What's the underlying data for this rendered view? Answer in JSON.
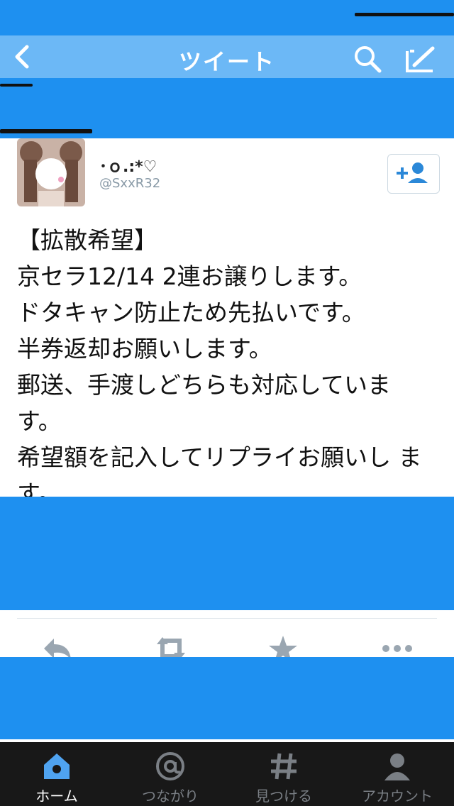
{
  "nav": {
    "back_icon": "back-chevron-icon",
    "title": "ツイート",
    "search_icon": "search-icon",
    "compose_icon": "compose-icon"
  },
  "tweet": {
    "user_name": "･ｏ.:*♡",
    "handle": "@SxxR32",
    "follow_icon": "add-user-icon",
    "lines": [
      "【拡散希望】",
      "京セラ12/14 2連お譲りします。",
      "ドタキャン防止ため先払いです。",
      "半券返却お願いします。",
      "郵送、手渡しどちらも対応していま す。",
      "希望額を記入してリプライお願いし ます。"
    ]
  },
  "actions": [
    {
      "name": "reply",
      "icon": "reply-icon"
    },
    {
      "name": "retweet",
      "icon": "retweet-icon"
    },
    {
      "name": "favorite",
      "icon": "star-icon"
    },
    {
      "name": "more",
      "icon": "more-icon"
    }
  ],
  "tabbar": {
    "items": [
      {
        "label": "ホーム",
        "icon": "home-icon",
        "active": true
      },
      {
        "label": "つながり",
        "icon": "at-icon",
        "active": false
      },
      {
        "label": "見つける",
        "icon": "hashtag-icon",
        "active": false
      },
      {
        "label": "アカウント",
        "icon": "account-icon",
        "active": false
      }
    ]
  },
  "colors": {
    "accent": "#1e90f0",
    "tab_active": "#ffffff",
    "tab_inactive": "#7a7f85"
  }
}
